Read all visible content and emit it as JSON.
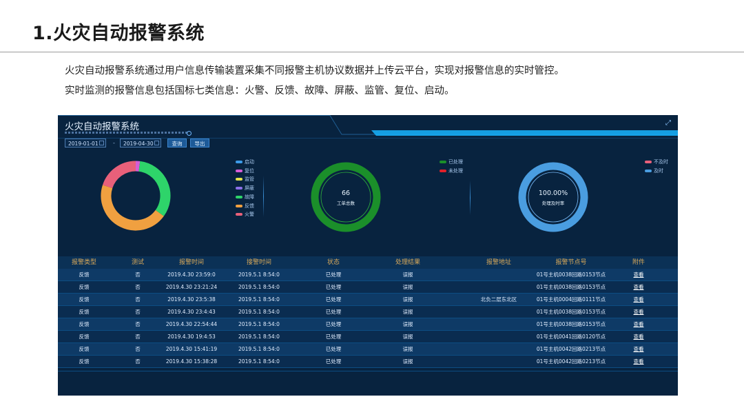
{
  "slide": {
    "title": "1.火灾自动报警系统",
    "desc1": "火灾自动报警系统通过用户信息传输装置采集不同报警主机协议数据并上传云平台，实现对报警信息的实时管控。",
    "desc2": "实时监测的报警信息包括国标七类信息：火警、反馈、故障、屏蔽、监管、复位、启动。"
  },
  "panel": {
    "title": "火灾自动报警系统",
    "start_date": "2019-01-01",
    "separator": "-",
    "end_date": "2019-04-30",
    "query_label": "查询",
    "export_label": "导出"
  },
  "alarm_types": {
    "legend": [
      {
        "label": "启动",
        "color": "#3d9be9"
      },
      {
        "label": "复位",
        "color": "#d65cd6"
      },
      {
        "label": "监管",
        "color": "#e4e34b"
      },
      {
        "label": "屏蔽",
        "color": "#8b6fe8"
      },
      {
        "label": "故障",
        "color": "#2ed46a"
      },
      {
        "label": "反馈",
        "color": "#f0a040"
      },
      {
        "label": "火警",
        "color": "#e8607a"
      }
    ],
    "segments": [
      {
        "label": "复位",
        "value": 2,
        "color": "#d65cd6"
      },
      {
        "label": "故障",
        "value": 33,
        "color": "#2ed46a"
      },
      {
        "label": "反馈",
        "value": 45,
        "color": "#f0a040"
      },
      {
        "label": "火警",
        "value": 20,
        "color": "#e8607a"
      }
    ]
  },
  "work_orders": {
    "value": "66",
    "label": "工单总数",
    "legend": [
      {
        "label": "已处理",
        "color": "#1b8f2a"
      },
      {
        "label": "未处理",
        "color": "#e0202a"
      }
    ],
    "processed_fraction": 1.0
  },
  "timeliness": {
    "value": "100.00%",
    "label": "处理及时率",
    "legend": [
      {
        "label": "不及时",
        "color": "#e8607a"
      },
      {
        "label": "及时",
        "color": "#4a9de0"
      }
    ],
    "on_time_fraction": 1.0
  },
  "table": {
    "headers": [
      "报警类型",
      "测试",
      "报警时间",
      "接警时间",
      "状态",
      "处理结果",
      "报警地址",
      "报警节点号",
      "附件"
    ],
    "rows": [
      [
        "反馈",
        "否",
        "2019.4.30 23:59:0",
        "2019.5.1 8:54:0",
        "已处理",
        "误报",
        "",
        "01号主机0038回路0153节点",
        "查看"
      ],
      [
        "反馈",
        "否",
        "2019.4.30 23:21:24",
        "2019.5.1 8:54:0",
        "已处理",
        "误报",
        "",
        "01号主机0038回路0153节点",
        "查看"
      ],
      [
        "反馈",
        "否",
        "2019.4.30 23:5:38",
        "2019.5.1 8:54:0",
        "已处理",
        "误报",
        "北负二层东北区",
        "01号主机0004回路0111节点",
        "查看"
      ],
      [
        "反馈",
        "否",
        "2019.4.30 23:4:43",
        "2019.5.1 8:54:0",
        "已处理",
        "误报",
        "",
        "01号主机0038回路0153节点",
        "查看"
      ],
      [
        "反馈",
        "否",
        "2019.4.30 22:54:44",
        "2019.5.1 8:54:0",
        "已处理",
        "误报",
        "",
        "01号主机0038回路0153节点",
        "查看"
      ],
      [
        "反馈",
        "否",
        "2019.4.30 19:4:53",
        "2019.5.1 8:54:0",
        "已处理",
        "误报",
        "",
        "01号主机0041回路0120节点",
        "查看"
      ],
      [
        "反馈",
        "否",
        "2019.4.30 15:41:19",
        "2019.5.1 8:54:0",
        "已处理",
        "误报",
        "",
        "01号主机0042回路0213节点",
        "查看"
      ],
      [
        "反馈",
        "否",
        "2019.4.30 15:38:28",
        "2019.5.1 8:54:0",
        "已处理",
        "误报",
        "",
        "01号主机0042回路0213节点",
        "查看"
      ]
    ]
  }
}
